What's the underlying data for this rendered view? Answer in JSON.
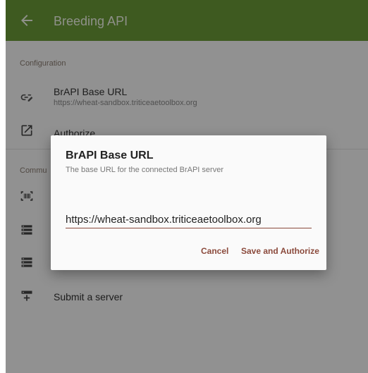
{
  "appbar": {
    "title": "Breeding API",
    "back_icon": "arrow-left-icon"
  },
  "configuration": {
    "header": "Configuration",
    "base_url": {
      "title": "BrAPI Base URL",
      "summary": "https://wheat-sandbox.triticeaetoolbox.org"
    },
    "authorize": {
      "title": "Authorize"
    }
  },
  "community": {
    "header_partial": "Commu",
    "submit": {
      "title": "Submit a server"
    }
  },
  "dialog": {
    "title": "BrAPI Base URL",
    "message": "The base URL for the connected BrAPI server",
    "input_value": "https://wheat-sandbox.triticeaetoolbox.org",
    "cancel_label": "Cancel",
    "save_label": "Save and Authorize"
  },
  "colors": {
    "appbar": "#6b9b37",
    "accent": "#8b4a3c"
  }
}
